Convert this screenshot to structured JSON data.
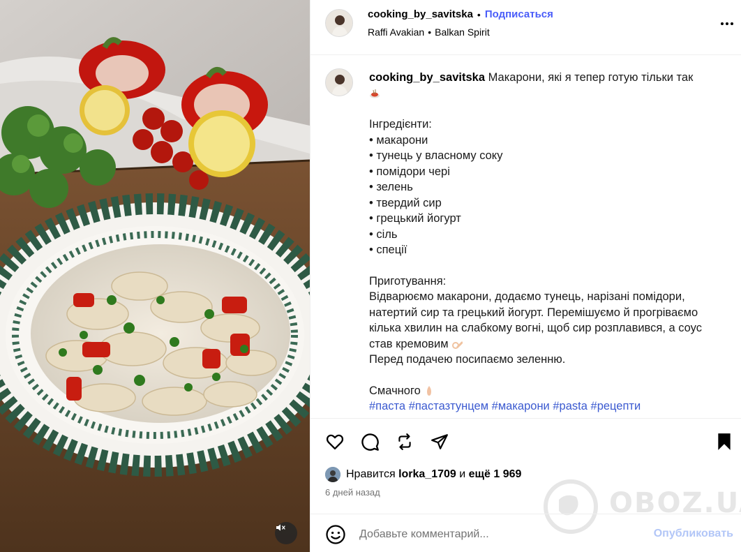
{
  "post": {
    "username": "cooking_by_savitska",
    "follow_label": "Подписаться",
    "separator": "•",
    "audio": {
      "artist": "Raffi Avakian",
      "track": "Balkan Spirit"
    }
  },
  "caption": {
    "title": "Макарони, які я тепер готую тільки так",
    "ingredients_heading": "Інгредієнти:",
    "ingredients": [
      "• макарони",
      "• тунець у власному соку",
      "• помідори чері",
      "• зелень",
      "• твердий сир",
      "• грецький йогурт",
      "• сіль",
      "• спеції"
    ],
    "method_heading": "Приготування:",
    "method_text": "Відварюємо макарони, додаємо тунець, нарізані помідори, натертий сир та грецький йогурт. Перемішуємо й прогріваємо кілька хвилин на слабкому вогні, щоб сир розплавився, а соус став кремовим",
    "serving_text": "Перед подачею посипаємо зеленню.",
    "closing": "Смачного",
    "hashtags": [
      "#паста",
      "#пастазтунцем",
      "#макарони",
      "#pasta",
      "#рецепти"
    ]
  },
  "likes": {
    "prefix": "Нравится",
    "liked_by": "lorka_1709",
    "conjunction": "и",
    "others": "ещё 1 969"
  },
  "timestamp": "6 дней назад",
  "comment": {
    "placeholder": "Добавьте комментарий...",
    "publish_label": "Опубликовать"
  },
  "watermark": {
    "text": "OBOZ.UA"
  },
  "icons": {
    "more": "more-options-icon",
    "like": "heart-icon",
    "comment": "comment-bubble-icon",
    "repost": "repost-icon",
    "share": "send-icon",
    "save": "bookmark-icon",
    "mute": "speaker-muted-icon",
    "emoji": "smiley-icon"
  },
  "colors": {
    "follow": "#4a5df9",
    "hashtag": "#3b5ad0",
    "publish_disabled": "#b2c6f7",
    "muted_text": "#737373"
  }
}
